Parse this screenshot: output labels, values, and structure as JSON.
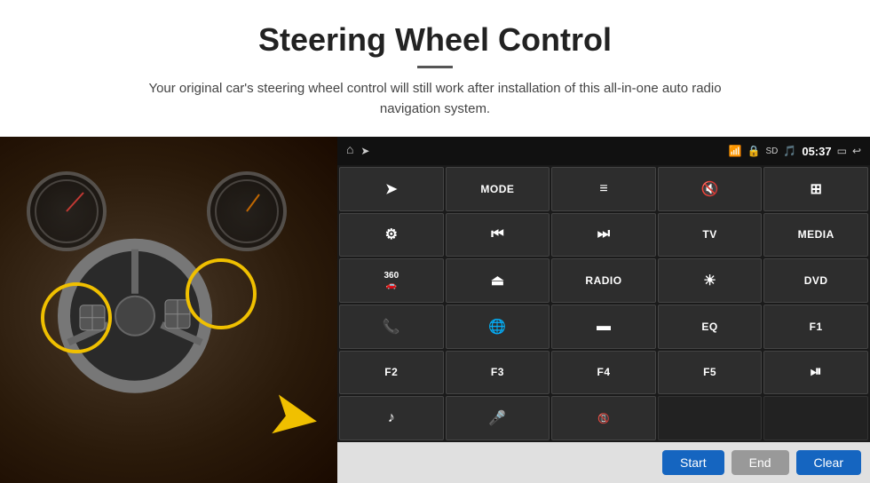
{
  "header": {
    "title": "Steering Wheel Control",
    "divider": true,
    "subtitle": "Your original car's steering wheel control will still work after installation of this all-in-one auto radio navigation system."
  },
  "status_bar": {
    "time": "05:37",
    "icons": [
      "wifi",
      "lock",
      "sd-card",
      "bluetooth",
      "back"
    ]
  },
  "button_grid": {
    "rows": [
      [
        {
          "type": "icon",
          "icon": "navigate",
          "label": "navigate"
        },
        {
          "type": "text",
          "text": "MODE"
        },
        {
          "type": "icon",
          "icon": "list",
          "label": "list"
        },
        {
          "type": "icon",
          "icon": "volume-off",
          "label": "volume-off"
        },
        {
          "type": "icon",
          "icon": "apps",
          "label": "apps"
        }
      ],
      [
        {
          "type": "icon",
          "icon": "settings-circle",
          "label": "settings"
        },
        {
          "type": "icon",
          "icon": "rewind",
          "label": "rewind"
        },
        {
          "type": "icon",
          "icon": "fast-forward",
          "label": "fast-forward"
        },
        {
          "type": "text",
          "text": "TV"
        },
        {
          "type": "text",
          "text": "MEDIA"
        }
      ],
      [
        {
          "type": "text",
          "text": "360"
        },
        {
          "type": "icon",
          "icon": "eject",
          "label": "eject"
        },
        {
          "type": "text",
          "text": "RADIO"
        },
        {
          "type": "icon",
          "icon": "brightness",
          "label": "brightness"
        },
        {
          "type": "text",
          "text": "DVD"
        }
      ],
      [
        {
          "type": "icon",
          "icon": "phone",
          "label": "phone"
        },
        {
          "type": "icon",
          "icon": "globe",
          "label": "browser"
        },
        {
          "type": "icon",
          "icon": "crop-landscape",
          "label": "display"
        },
        {
          "type": "text",
          "text": "EQ"
        },
        {
          "type": "text",
          "text": "F1"
        }
      ],
      [
        {
          "type": "text",
          "text": "F2"
        },
        {
          "type": "text",
          "text": "F3"
        },
        {
          "type": "text",
          "text": "F4"
        },
        {
          "type": "text",
          "text": "F5"
        },
        {
          "type": "icon",
          "icon": "play-pause",
          "label": "play-pause"
        }
      ],
      [
        {
          "type": "icon",
          "icon": "music",
          "label": "music"
        },
        {
          "type": "icon",
          "icon": "mic",
          "label": "microphone"
        },
        {
          "type": "icon",
          "icon": "phone-hangup",
          "label": "phone-hangup"
        },
        {
          "type": "empty",
          "text": ""
        },
        {
          "type": "empty",
          "text": ""
        }
      ]
    ]
  },
  "bottom_buttons": {
    "start": "Start",
    "end": "End",
    "clear": "Clear"
  },
  "colors": {
    "accent_blue": "#1565c0",
    "button_bg": "#2d2d2d",
    "status_bg": "#111111",
    "bottom_bar_bg": "#e0e0e0"
  }
}
